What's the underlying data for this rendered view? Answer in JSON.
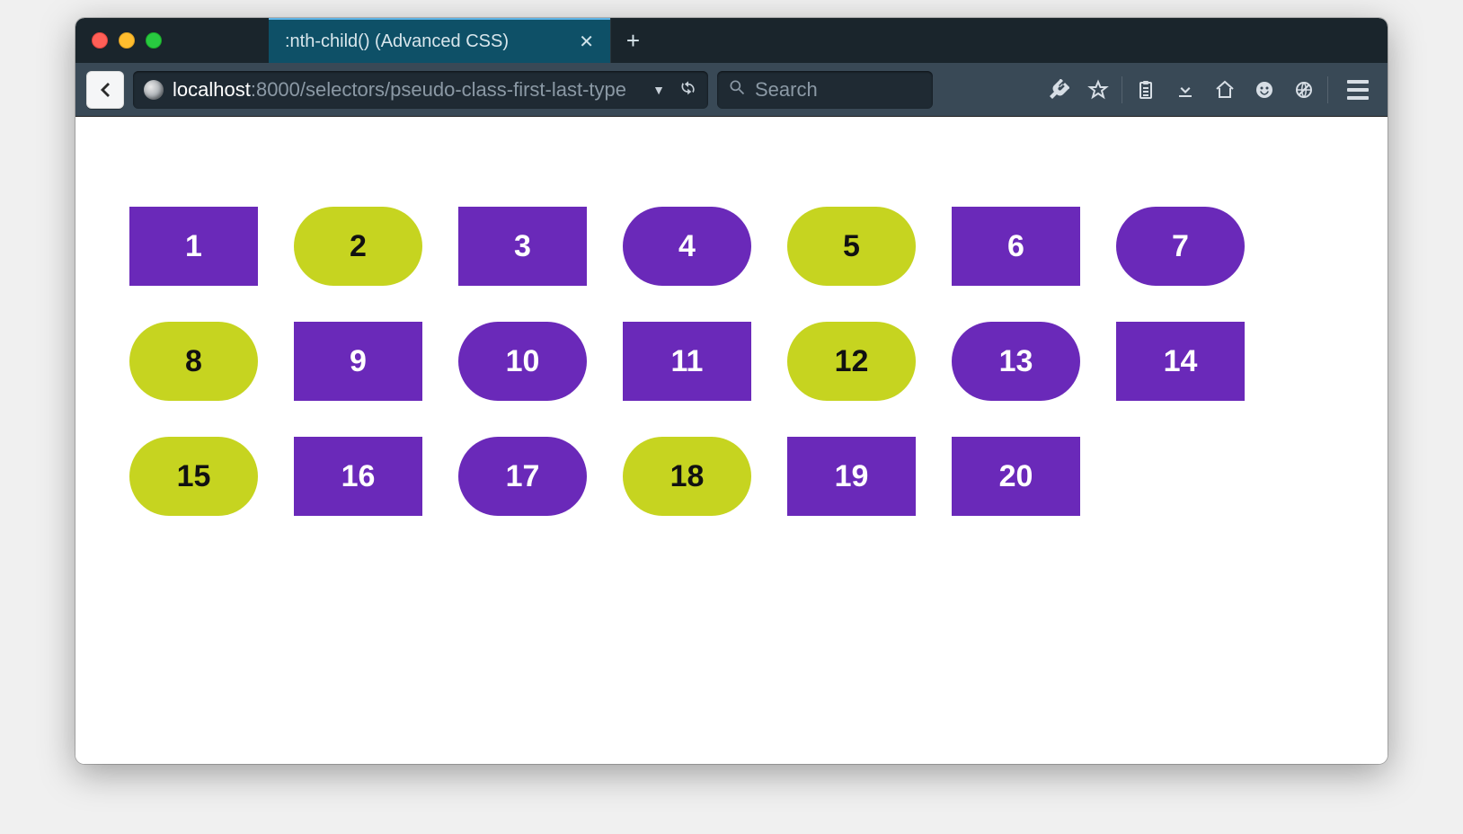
{
  "tab": {
    "title": ":nth-child() (Advanced CSS)"
  },
  "url": {
    "host": "localhost",
    "port_path": ":8000/selectors/pseudo-class-first-last-type"
  },
  "search": {
    "placeholder": "Search"
  },
  "colors": {
    "purple": "#6a29b9",
    "lime": "#c6d420"
  },
  "boxes": [
    {
      "n": "1",
      "color": "purple",
      "shape": "rect"
    },
    {
      "n": "2",
      "color": "lime",
      "shape": "pill"
    },
    {
      "n": "3",
      "color": "purple",
      "shape": "rect"
    },
    {
      "n": "4",
      "color": "purple",
      "shape": "pill"
    },
    {
      "n": "5",
      "color": "lime",
      "shape": "pill"
    },
    {
      "n": "6",
      "color": "purple",
      "shape": "rect"
    },
    {
      "n": "7",
      "color": "purple",
      "shape": "pill"
    },
    {
      "n": "8",
      "color": "lime",
      "shape": "pill"
    },
    {
      "n": "9",
      "color": "purple",
      "shape": "rect"
    },
    {
      "n": "10",
      "color": "purple",
      "shape": "pill"
    },
    {
      "n": "11",
      "color": "purple",
      "shape": "rect"
    },
    {
      "n": "12",
      "color": "lime",
      "shape": "pill"
    },
    {
      "n": "13",
      "color": "purple",
      "shape": "pill"
    },
    {
      "n": "14",
      "color": "purple",
      "shape": "rect"
    },
    {
      "n": "15",
      "color": "lime",
      "shape": "pill"
    },
    {
      "n": "16",
      "color": "purple",
      "shape": "rect"
    },
    {
      "n": "17",
      "color": "purple",
      "shape": "pill"
    },
    {
      "n": "18",
      "color": "lime",
      "shape": "pill"
    },
    {
      "n": "19",
      "color": "purple",
      "shape": "rect"
    },
    {
      "n": "20",
      "color": "purple",
      "shape": "rect"
    }
  ]
}
